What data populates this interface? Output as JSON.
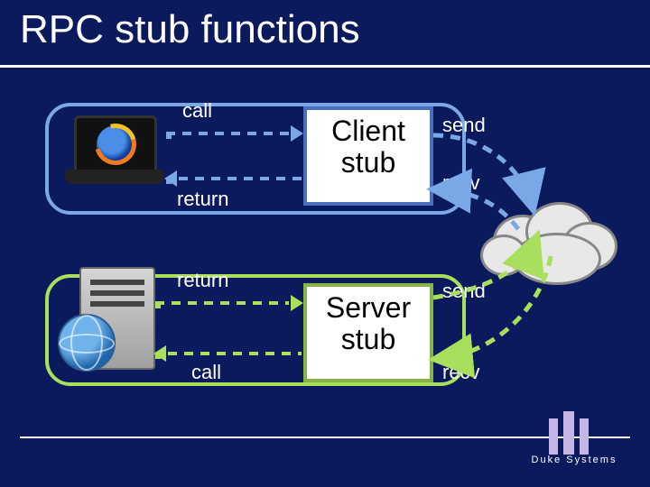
{
  "title": "RPC stub functions",
  "client": {
    "stub_label": "Client\nstub",
    "call_label": "call",
    "return_label": "return",
    "send_label": "send",
    "recv_label": "recv"
  },
  "server": {
    "stub_label": "Server\nstub",
    "call_label": "call",
    "return_label": "return",
    "send_label": "send",
    "recv_label": "recv"
  },
  "footer": {
    "logo_text": "Duke Systems"
  },
  "colors": {
    "bg": "#0a1a5c",
    "client_box": "#7aa8e6",
    "client_stub_border": "#4a6fbf",
    "server_box": "#a8e05e",
    "server_stub_border": "#86b543",
    "net_client": "#7aa8e6",
    "net_server": "#a8e05e"
  }
}
